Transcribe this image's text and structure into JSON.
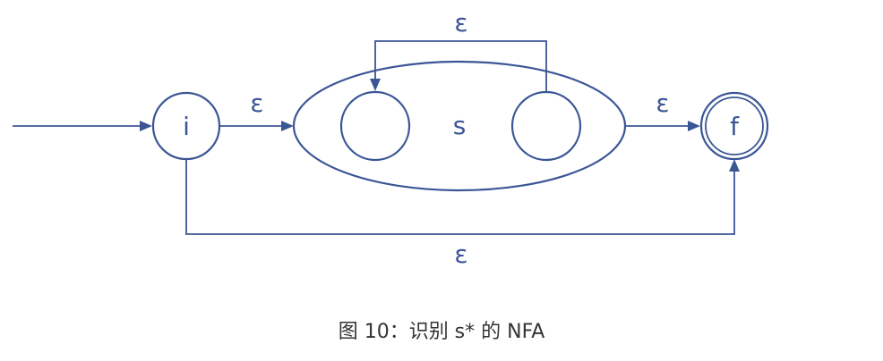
{
  "diagram": {
    "states": {
      "initial": "i",
      "final": "f",
      "sub_automaton": "s"
    },
    "transitions": {
      "loop_label": "ε",
      "i_to_s": "ε",
      "s_to_f": "ε",
      "bypass": "ε"
    },
    "color": "#3b5696"
  },
  "caption": "图 10：识别 s* 的 NFA"
}
